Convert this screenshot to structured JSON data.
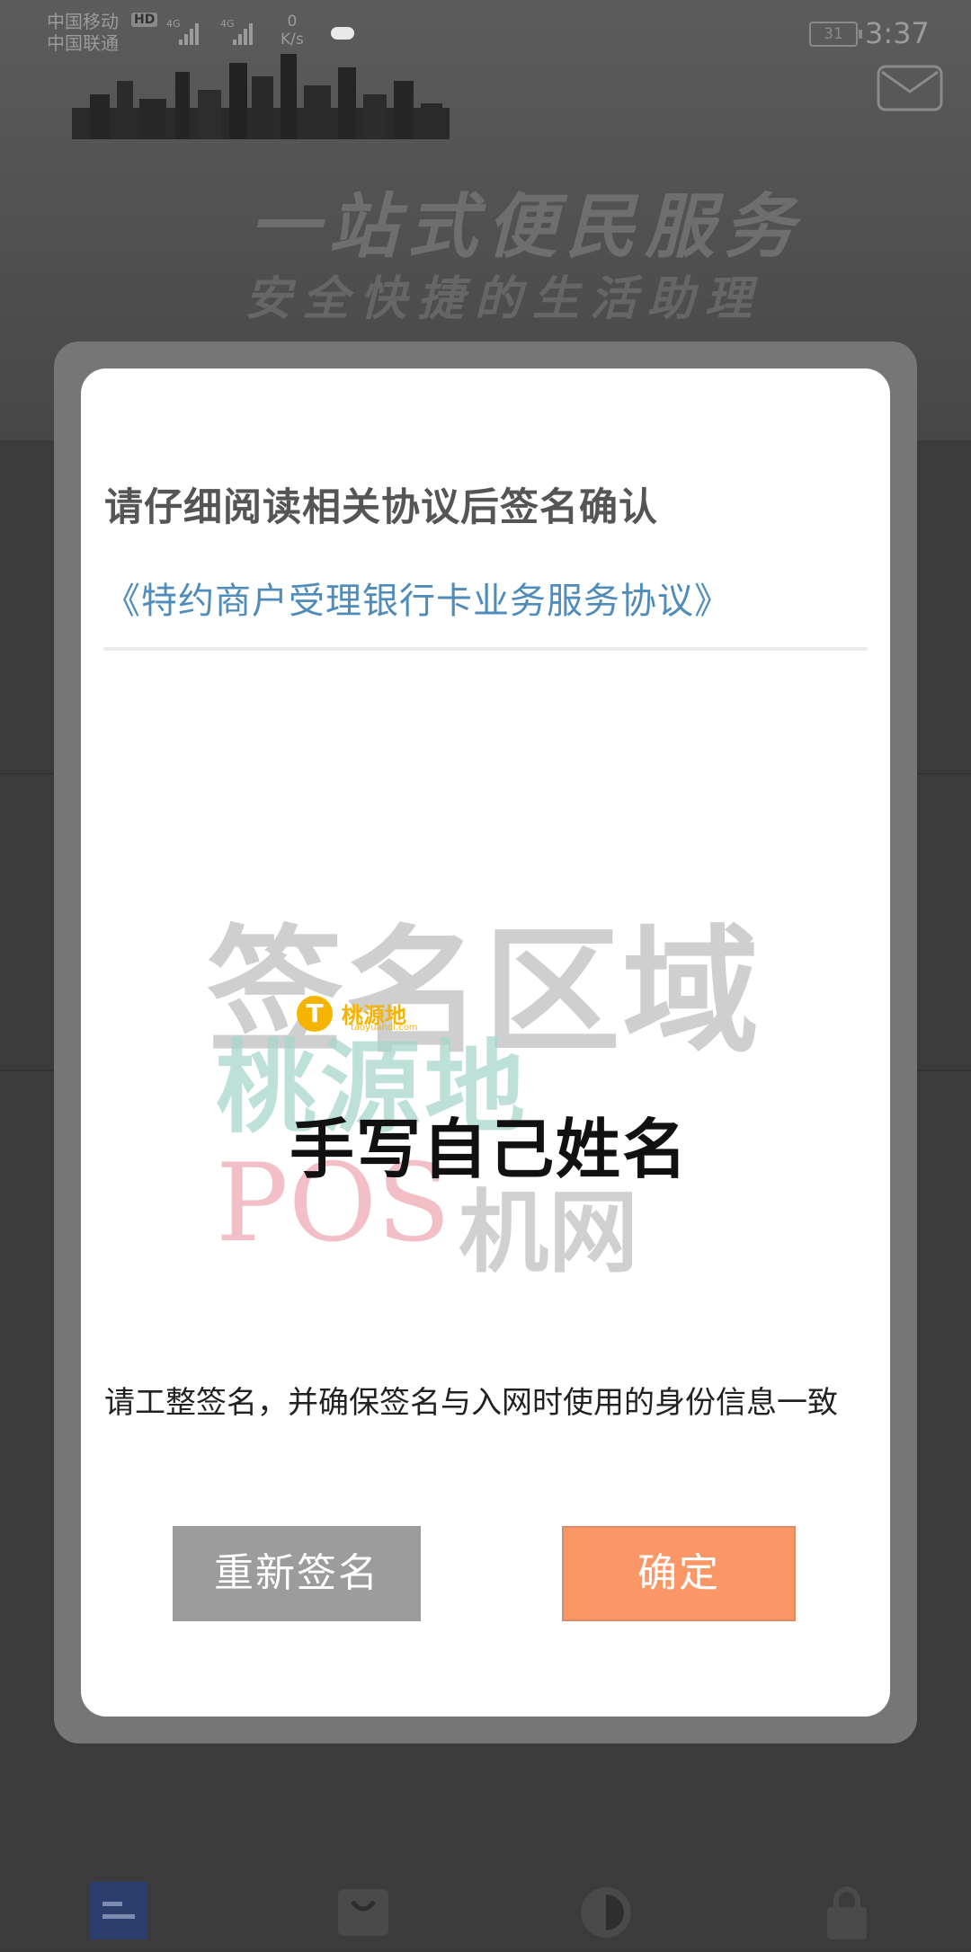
{
  "status_bar": {
    "carrier_1": "中国移动",
    "carrier_2": "中国联通",
    "hd_badge": "HD",
    "signal_1_label": "4G",
    "signal_2_label": "4G",
    "speed_value": "0",
    "speed_unit": "K/s",
    "battery": "31",
    "time": "3:37"
  },
  "background": {
    "slogan_main": "一站式便民服务",
    "slogan_sub": "安全快捷的生活助理"
  },
  "dialog": {
    "title": "请仔细阅读相关协议后签名确认",
    "agreement_link": "《特约商户受理银行卡业务服务协议》",
    "signature_area_watermark": "签名区域",
    "signature_note": "手写自己姓名",
    "hint": "请工整签名，并确保签名与入网时使用的身份信息一致",
    "resign_label": "重新签名",
    "confirm_label": "确定"
  },
  "image_watermark": {
    "logo_letter": "T",
    "logo_text": "桃源地",
    "logo_sub": "taoyuandi.com",
    "site_name_1": "桃源地",
    "site_name_2": "POS",
    "site_name_3": "机网"
  },
  "tabbar": {
    "icons": [
      "home-list-icon",
      "shop-bag-icon",
      "chart-pie-icon",
      "lock-icon"
    ]
  },
  "colors": {
    "link": "#4f8cbb",
    "confirm": "#fb9766",
    "resign": "#9c9c9c"
  }
}
